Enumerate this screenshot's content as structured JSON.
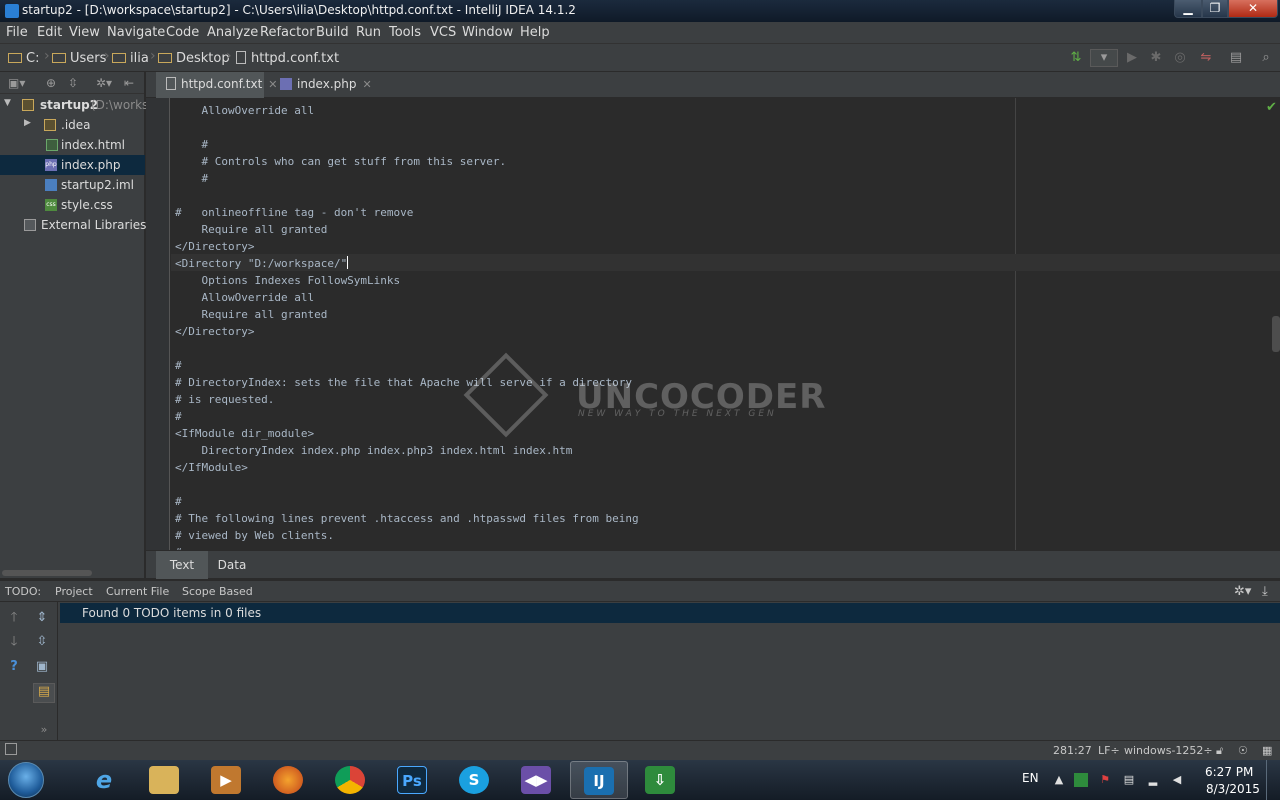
{
  "window": {
    "title": "startup2 - [D:\\workspace\\startup2] - C:\\Users\\ilia\\Desktop\\httpd.conf.txt - IntelliJ IDEA 14.1.2",
    "minimize": "▁",
    "maximize": "❐",
    "close": "✕"
  },
  "menu": [
    "File",
    "Edit",
    "View",
    "Navigate",
    "Code",
    "Analyze",
    "Refactor",
    "Build",
    "Run",
    "Tools",
    "VCS",
    "Window",
    "Help"
  ],
  "breadcrumbs": [
    "C:",
    "Users",
    "ilia",
    "Desktop",
    "httpd.conf.txt"
  ],
  "project": {
    "root_label": "startup2",
    "root_path": "(D:\\worksp",
    "items": [
      ".idea",
      "index.html",
      "index.php",
      "startup2.iml",
      "style.css",
      "External Libraries"
    ],
    "selected": "index.php"
  },
  "tabs": [
    {
      "label": "httpd.conf.txt",
      "close": "✕",
      "active": true
    },
    {
      "label": "index.php",
      "close": "✕",
      "active": false
    }
  ],
  "code_lines": [
    "    AllowOverride all",
    "",
    "    #",
    "    # Controls who can get stuff from this server.",
    "    #",
    "",
    "#   onlineoffline tag - don't remove",
    "    Require all granted",
    "</Directory>",
    "<Directory \"D:/workspace/\"",
    "    Options Indexes FollowSymLinks",
    "    AllowOverride all",
    "    Require all granted",
    "</Directory>",
    "",
    "#",
    "# DirectoryIndex: sets the file that Apache will serve if a directory",
    "# is requested.",
    "#",
    "<IfModule dir_module>",
    "    DirectoryIndex index.php index.php3 index.html index.htm",
    "</IfModule>",
    "",
    "#",
    "# The following lines prevent .htaccess and .htpasswd files from being",
    "# viewed by Web clients.",
    "#"
  ],
  "watermark": {
    "name": "UNCOCODER",
    "tagline": "NEW WAY TO THE NEXT GEN"
  },
  "bottom_tabs": [
    "Text",
    "Data"
  ],
  "todo": {
    "label": "TODO:",
    "tabs": [
      "Project",
      "Current File",
      "Scope Based"
    ],
    "result": "Found 0 TODO items in 0 files"
  },
  "status": {
    "position": "281:27",
    "line_sep": "LF÷",
    "encoding": "windows-1252÷"
  },
  "taskbar": {
    "apps": [
      "internet-explorer",
      "file-explorer",
      "media-player",
      "firefox",
      "chrome",
      "photoshop",
      "skype",
      "visual-studio",
      "intellij-idea",
      "download-manager"
    ],
    "active": "intellij-idea",
    "language": "EN",
    "time": "6:27 PM",
    "date": "8/3/2015"
  },
  "colors": {
    "background": "#2b2b2b",
    "panel": "#3c3f41",
    "selection": "#0d293e",
    "code_text": "#a9b7c6"
  }
}
